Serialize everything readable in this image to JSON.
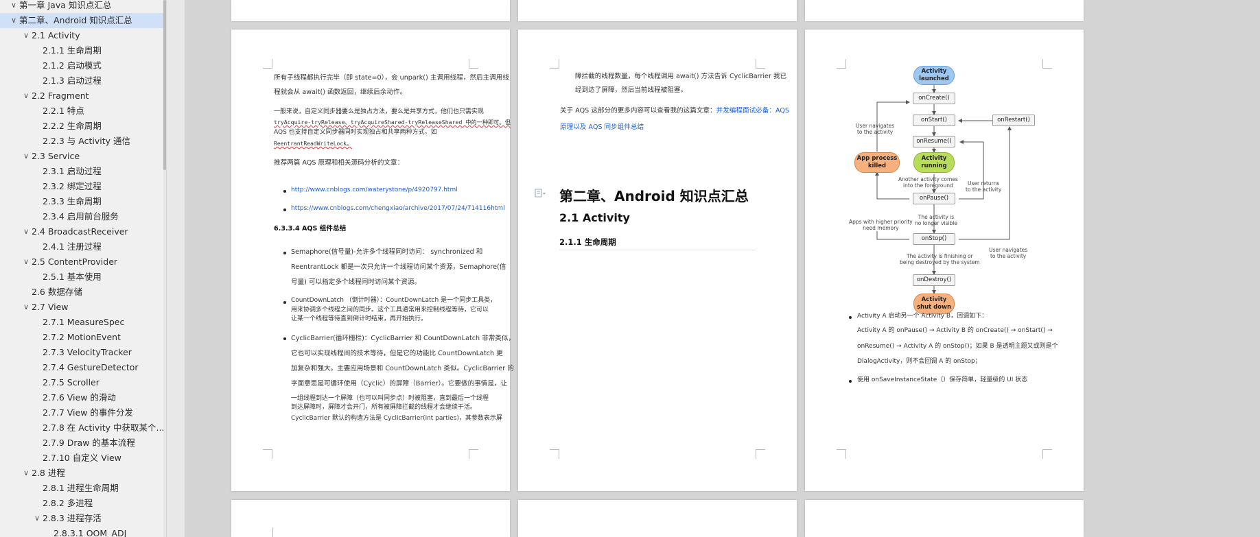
{
  "nav": {
    "items": [
      {
        "label": "第一章 Java 知识点汇总",
        "level": 0,
        "chev": "v",
        "sel": false
      },
      {
        "label": "第二章、Android 知识点汇总",
        "level": 0,
        "chev": "v",
        "sel": true
      },
      {
        "label": "2.1 Activity",
        "level": 1,
        "chev": "v"
      },
      {
        "label": "2.1.1 生命周期",
        "level": 2
      },
      {
        "label": "2.1.2 启动模式",
        "level": 2
      },
      {
        "label": "2.1.3 启动过程",
        "level": 2
      },
      {
        "label": "2.2 Fragment",
        "level": 1,
        "chev": "v"
      },
      {
        "label": "2.2.1 特点",
        "level": 2
      },
      {
        "label": "2.2.2 生命周期",
        "level": 2
      },
      {
        "label": "2.2.3 与 Activity 通信",
        "level": 2
      },
      {
        "label": "2.3 Service",
        "level": 1,
        "chev": "v"
      },
      {
        "label": "2.3.1 启动过程",
        "level": 2
      },
      {
        "label": "2.3.2 绑定过程",
        "level": 2
      },
      {
        "label": "2.3.3 生命周期",
        "level": 2
      },
      {
        "label": "2.3.4 启用前台服务",
        "level": 2
      },
      {
        "label": "2.4 BroadcastReceiver",
        "level": 1,
        "chev": "v"
      },
      {
        "label": "2.4.1 注册过程",
        "level": 2
      },
      {
        "label": "2.5 ContentProvider",
        "level": 1,
        "chev": "v"
      },
      {
        "label": "2.5.1 基本使用",
        "level": 2
      },
      {
        "label": "2.6 数据存储",
        "level": 1
      },
      {
        "label": "2.7 View",
        "level": 1,
        "chev": "v"
      },
      {
        "label": "2.7.1 MeasureSpec",
        "level": 2
      },
      {
        "label": "2.7.2 MotionEvent",
        "level": 2
      },
      {
        "label": "2.7.3 VelocityTracker",
        "level": 2
      },
      {
        "label": "2.7.4 GestureDetector",
        "level": 2
      },
      {
        "label": "2.7.5 Scroller",
        "level": 2
      },
      {
        "label": "2.7.6 View 的滑动",
        "level": 2
      },
      {
        "label": "2.7.7 View 的事件分发",
        "level": 2
      },
      {
        "label": "2.7.8 在 Activity 中获取某个...",
        "level": 2
      },
      {
        "label": "2.7.9 Draw 的基本流程",
        "level": 2
      },
      {
        "label": "2.7.10 自定义 View",
        "level": 2
      },
      {
        "label": "2.8 进程",
        "level": 1,
        "chev": "v"
      },
      {
        "label": "2.8.1 进程生命周期",
        "level": 2
      },
      {
        "label": "2.8.2 多进程",
        "level": 2
      },
      {
        "label": "2.8.3 进程存活",
        "level": 2,
        "chev": "v"
      },
      {
        "label": "2.8.3.1 OOM_ADJ",
        "level": 3
      }
    ]
  },
  "page1": {
    "p1_l1": "所有子线程都执行完毕（即 state=0），会 unpark() 主调用线程，然后主调用线",
    "p1_l2": "程就会从 await() 函数返回，继续后余动作。",
    "p2_l1": "一般来说，自定义同步器要么是独占方法，要么是共享方式，他们也只需实现",
    "p2_l2": "tryAcquire-tryRelease、tryAcquireShared-tryReleaseShared 中的一种即可。但",
    "p2_l3": "AQS 也支持自定义同步器同时实现独占和共享两种方式，如",
    "p2_l4": "ReentrantReadWriteLock。",
    "p3": "推荐两篇 AQS 原理和相关源码分析的文章：",
    "link1": "http://www.cnblogs.com/waterystone/p/4920797.html",
    "link2": "https://www.cnblogs.com/chengxiao/archive/2017/07/24/714116html",
    "heading": "6.3.3.4 AQS 组件总结",
    "b1_l1": "Semaphore(信号量)-允许多个线程同时访问：   synchronized  和",
    "b1_l2": "ReentrantLock 都是一次只允许一个线程访问某个资源，Semaphore(信",
    "b1_l3": "号量) 可以指定多个线程同时访问某个资源。",
    "b2_l1": "CountDownLatch （倒计时器）：CountDownLatch 是一个同步工具类，",
    "b2_l2": "用来协调多个线程之间的同步。这个工具通常用来控制线程等待，它可以",
    "b2_l3": "让某一个线程等待直到倒计时结束，再开始执行。",
    "b3_l1": "CyclicBarrier(循环栅栏)：CyclicBarrier 和 CountDownLatch 非常类似，",
    "b3_l2": "它也可以实现线程间的技术等待，但是它的功能比 CountDownLatch 更",
    "b3_l3": "加复杂和强大。主要应用场景和 CountDownLatch 类似。CyclicBarrier 的",
    "b3_l4": "字面意思是可循环使用（Cyclic）的屏障（Barrier）。它要做的事情是，让",
    "b3_l5": "一组线程到达一个屏障（也可以叫同步点）时被阻塞，直到最后一个线程",
    "b3_l6": "到达屏障时，屏障才会开门，所有被屏障拦截的线程才会继续干活。",
    "b3_l7": "CyclicBarrier 默认的构造方法是 CyclicBarrier(int parties)，其参数表示屏"
  },
  "page2": {
    "l1": "障拦截的线程数量，每个线程调用 await() 方法告诉 CyclicBarrier 我已",
    "l2": "经到达了屏障，然后当前线程被阻塞。",
    "l3a": "关于 AQS 这部分的更多内容可以查看我的这篇文章：",
    "l3b": "并发编程面试必备：AQS",
    "l4": "原理以及 AQS 同步组件总结",
    "chapter": "第二章、Android 知识点汇总",
    "section": "2.1 Activity",
    "subsection": "2.1.1  生命周期"
  },
  "page3": {
    "diagram": {
      "launched": "Activity launched",
      "oncreate": "onCreate()",
      "onstart": "onStart()",
      "onrestart": "onRestart()",
      "onresume": "onResume()",
      "running": "Activity running",
      "killed": "App process killed",
      "onpause": "onPause()",
      "onstop": "onStop()",
      "ondestroy": "onDestroy()",
      "shutdown": "Activity shut down",
      "n_nav1": "User navigates\nto the activity",
      "n_another": "Another activity comes\ninto the foreground",
      "n_returns": "User returns\nto the activity",
      "n_higher": "Apps with higher priority\nneed memory",
      "n_novis": "The activity is\nno longer visible",
      "n_nav2": "User navigates\nto the activity",
      "n_finish": "The activity is finishing or\nbeing destroyed by the system"
    },
    "b1_l1": "Activity A 启动另一个 Activity B，回调如下：",
    "b1_l2": "Activity A 的 onPause() → Activity B 的 onCreate() → onStart() →",
    "b1_l3": "onResume() → Activity A 的 onStop()；如果 B 是透明主题又或则是个",
    "b1_l4": "DialogActivity，则不会回调 A 的 onStop；",
    "b2": "使用 onSaveInstanceState（）保存简单，轻量级的 UI 状态"
  },
  "colors": {
    "blue_oval": "#9cc8f2",
    "green_oval": "#b9dc5a",
    "orange_oval": "#f6b07e",
    "selected_nav": "#cfe0f7",
    "link": "#1a5bd6"
  }
}
